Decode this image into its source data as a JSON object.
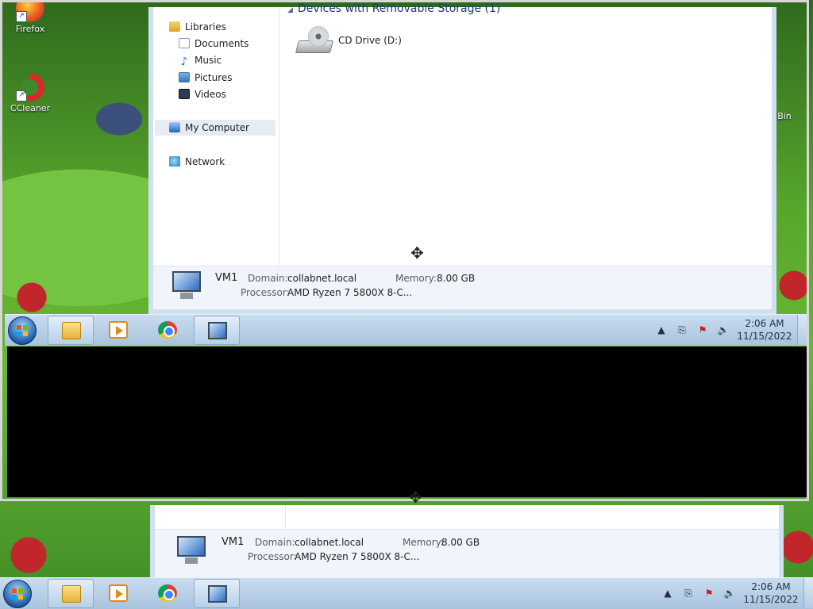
{
  "desktop": {
    "icons": [
      {
        "label": "Firefox"
      },
      {
        "label": "CCleaner"
      },
      {
        "label": "Bin"
      }
    ]
  },
  "explorer": {
    "nav": {
      "libraries": "Libraries",
      "documents": "Documents",
      "music": "Music",
      "pictures": "Pictures",
      "videos": "Videos",
      "my_computer": "My Computer",
      "network": "Network"
    },
    "group_header": "Devices with Removable Storage (1)",
    "drive_label": "CD Drive (D:)",
    "details": {
      "name": "VM1",
      "domain_key": "Domain:",
      "domain_val": "collabnet.local",
      "memory_key": "Memory:",
      "memory_val": "8.00 GB",
      "processor_key": "Processor:",
      "processor_val": "AMD Ryzen 7 5800X 8-C..."
    }
  },
  "taskbar": {
    "time": "2:06 AM",
    "date": "11/15/2022",
    "pinned": [
      {
        "icon": "folder-icon",
        "active": true
      },
      {
        "icon": "media-player-icon",
        "active": false
      },
      {
        "icon": "chrome-icon",
        "active": false
      },
      {
        "icon": "computer-icon",
        "active": true
      }
    ]
  },
  "colors": {
    "taskbar": "#b8cfe6",
    "explorer_border": "#cfe0f4",
    "selected_nav": "#e5ecf4"
  }
}
